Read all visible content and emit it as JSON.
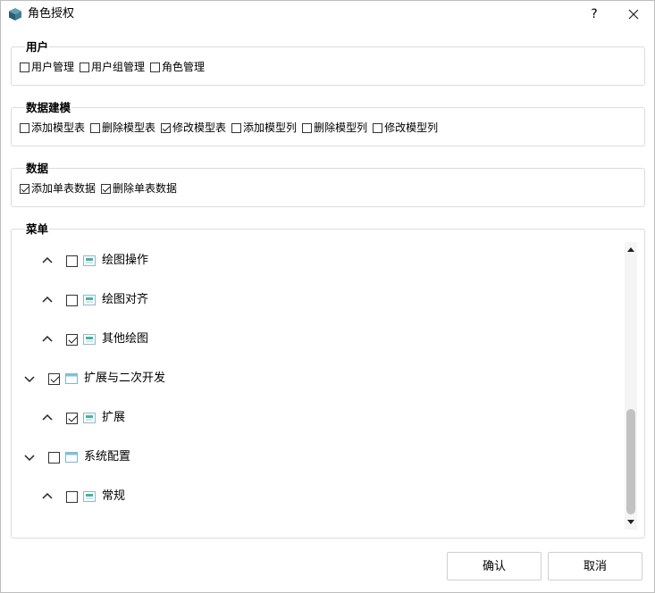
{
  "window": {
    "title": "角色授权",
    "help_label": "?"
  },
  "groups": {
    "user": {
      "title": "用户",
      "items": [
        {
          "label": "用户管理",
          "checked": false
        },
        {
          "label": "用户组管理",
          "checked": false
        },
        {
          "label": "角色管理",
          "checked": false
        }
      ]
    },
    "modeling": {
      "title": "数据建模",
      "items": [
        {
          "label": "添加模型表",
          "checked": false
        },
        {
          "label": "删除模型表",
          "checked": false
        },
        {
          "label": "修改模型表",
          "checked": true
        },
        {
          "label": "添加模型列",
          "checked": false
        },
        {
          "label": "删除模型列",
          "checked": false
        },
        {
          "label": "修改模型列",
          "checked": false
        }
      ]
    },
    "data": {
      "title": "数据",
      "items": [
        {
          "label": "添加单表数据",
          "checked": true
        },
        {
          "label": "删除单表数据",
          "checked": true
        }
      ]
    },
    "menu": {
      "title": "菜单",
      "tree": [
        {
          "label": "绘图操作",
          "level": 2,
          "expanded": true,
          "checked": false
        },
        {
          "label": "绘图对齐",
          "level": 2,
          "expanded": true,
          "checked": false
        },
        {
          "label": "其他绘图",
          "level": 2,
          "expanded": true,
          "checked": true
        },
        {
          "label": "扩展与二次开发",
          "level": 1,
          "expanded": false,
          "checked": true
        },
        {
          "label": "扩展",
          "level": 2,
          "expanded": true,
          "checked": true
        },
        {
          "label": "系统配置",
          "level": 1,
          "expanded": false,
          "checked": false
        },
        {
          "label": "常规",
          "level": 2,
          "expanded": true,
          "checked": false
        }
      ]
    }
  },
  "buttons": {
    "ok": "确认",
    "cancel": "取消"
  }
}
